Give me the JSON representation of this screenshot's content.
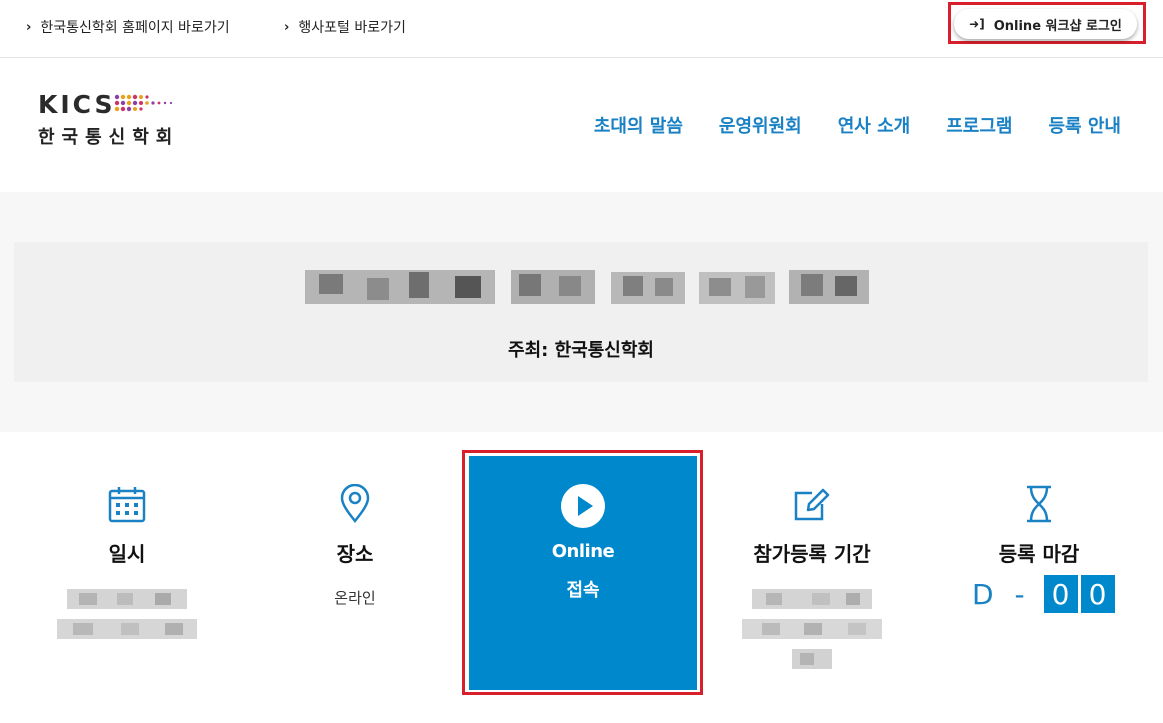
{
  "topbar": {
    "links": [
      {
        "label": "한국통신학회 홈페이지 바로가기"
      },
      {
        "label": "행사포털 바로가기"
      }
    ],
    "login_label": "Online 워크샵 로그인"
  },
  "header": {
    "logo_en": "KICS",
    "logo_ko": "한국통신학회",
    "nav": [
      {
        "label": "초대의 말씀"
      },
      {
        "label": "운영위원회"
      },
      {
        "label": "연사 소개"
      },
      {
        "label": "프로그램"
      },
      {
        "label": "등록 안내"
      }
    ]
  },
  "hero": {
    "host": "주최: 한국통신학회"
  },
  "cards": {
    "date": {
      "title": "일시",
      "icon": "calendar-icon"
    },
    "venue": {
      "title": "장소",
      "value": "온라인",
      "icon": "location-pin-icon"
    },
    "online": {
      "line1": "Online",
      "line2": "접속",
      "icon": "play-icon"
    },
    "registration": {
      "title": "참가등록 기간",
      "icon": "edit-icon"
    },
    "deadline": {
      "title": "등록 마감",
      "dday_label": "D -",
      "digits": [
        "0",
        "0"
      ],
      "icon": "hourglass-icon"
    }
  },
  "colors": {
    "accent": "#1a82c4",
    "online_bg": "#0088cc",
    "highlight_border": "#d7202b"
  }
}
